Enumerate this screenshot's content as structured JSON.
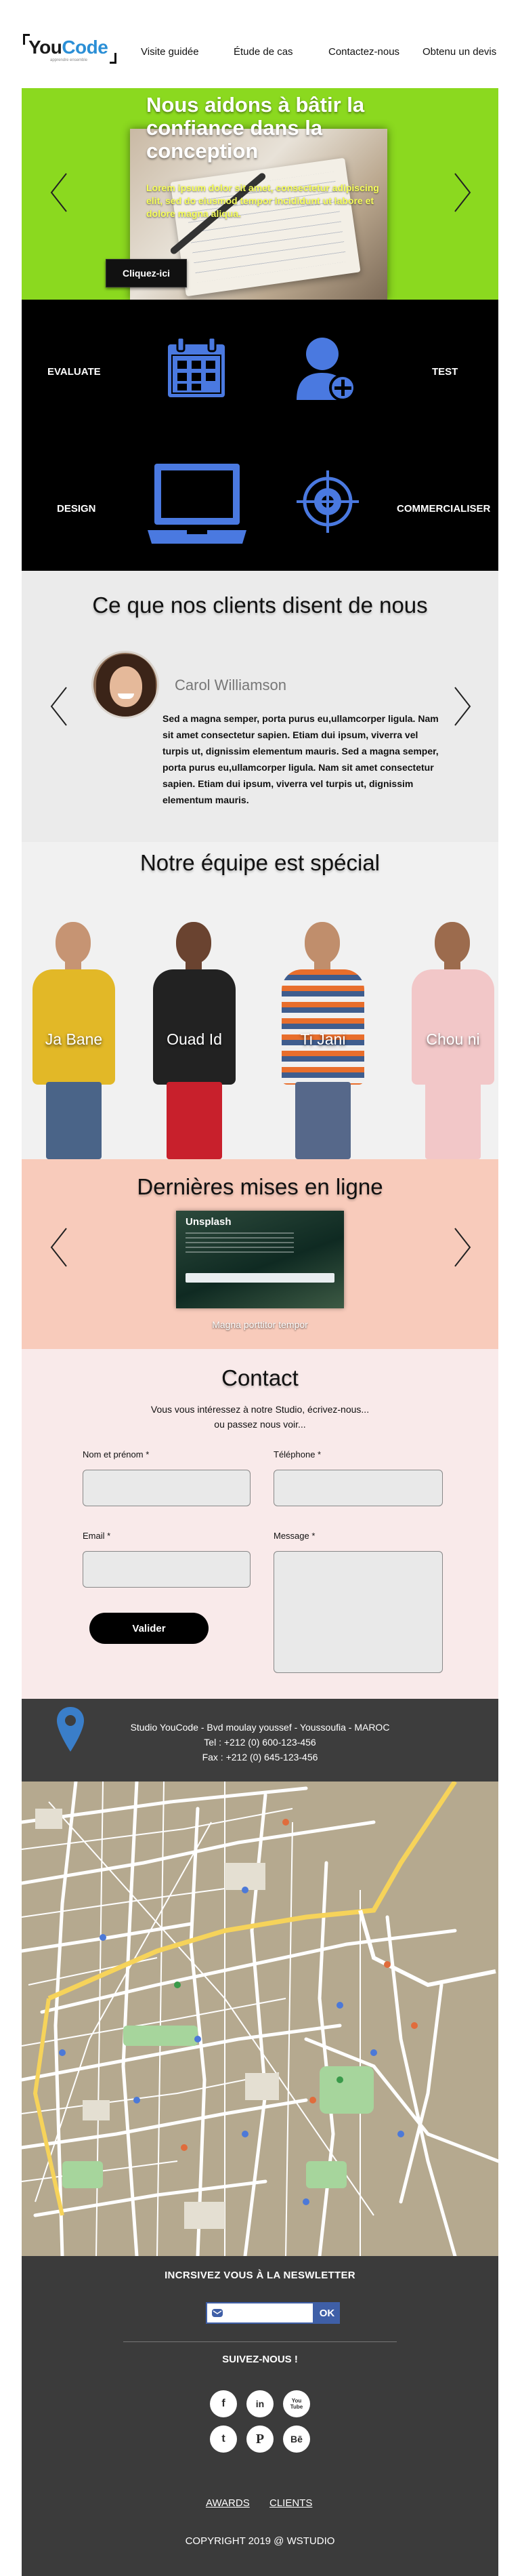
{
  "header": {
    "logo_you": "You",
    "logo_code": "Code",
    "logo_tagline": "apprendre ensemble",
    "nav": [
      "Visite guidée",
      "Étude de cas",
      "Contactez-nous",
      "Obtenu un devis"
    ]
  },
  "hero": {
    "title": "Nous aidons à bâtir la confiance dans la conception",
    "subtitle": "Lorem ipsum dolor sit amet, consectetur adipiscing elit, sed do eiusmod tempor incididunt ut labore et dolore magna aliqua.",
    "button": "Cliquez-ici"
  },
  "services": {
    "evaluate": "EVALUATE",
    "test": "TEST",
    "design": "DESIGN",
    "commercialiser": "COMMERCIALISER"
  },
  "testimonials": {
    "title": "Ce que nos clients disent de nous",
    "name": "Carol Williamson",
    "text": "Sed a magna semper, porta purus eu,ullamcorper ligula. Nam sit amet consectetur sapien. Etiam dui ipsum, viverra vel turpis ut, dignissim elementum mauris. Sed a magna semper, porta purus eu,ullamcorper ligula. Nam sit amet consectetur sapien. Etiam dui ipsum, viverra vel turpis ut, dignissim elementum mauris."
  },
  "team": {
    "title": "Notre équipe est spécial",
    "members": [
      "Ja Bane",
      "Ouad Id",
      "Ti Jani",
      "Chou ni"
    ]
  },
  "latest": {
    "title": "Dernières mises en ligne",
    "image_brand": "Unsplash",
    "caption": "Magna porttitor tempor"
  },
  "contact": {
    "title": "Contact",
    "intro_1": "Vous vous intéressez à notre Studio, écrivez-nous...",
    "intro_2": "ou passez nous voir...",
    "name_label": "Nom et prénom *",
    "phone_label": "Téléphone *",
    "email_label": "Email *",
    "message_label": "Message *",
    "submit": "Valider"
  },
  "address": {
    "line1": "Studio YouCode - Bvd moulay youssef - Youssoufia - MAROC",
    "tel": "Tel : +212 (0) 600-123-456",
    "fax": "Fax : +212 (0) 645-123-456"
  },
  "footer": {
    "newsletter_title": "INCRSIVEZ VOUS À LA NESWLETTER",
    "newsletter_button": "OK",
    "follow": "SUIVEZ-NOUS !",
    "social": {
      "facebook": "f",
      "linkedin": "in",
      "youtube": "You Tube",
      "twitter": "t",
      "pinterest": "P",
      "behance": "Bē"
    },
    "links": [
      "AWARDS",
      "CLIENTS"
    ],
    "copyright": "COPYRIGHT 2019 @ WSTUDIO"
  },
  "colors": {
    "hero_bg": "#8bd91f",
    "hero_subtitle": "#f7ff5a",
    "icon_blue": "#4a79e0",
    "testimonials_bg": "#ebebeb",
    "latest_bg": "#f8cbbb",
    "contact_bg": "#f9eaea",
    "footer_bg": "#3b3b3b",
    "newsletter_blue": "#3f5fa7"
  }
}
